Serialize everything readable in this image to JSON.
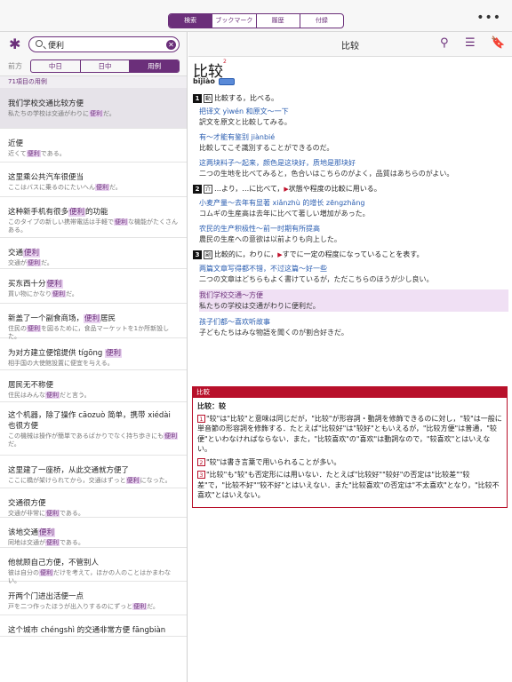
{
  "tabs": [
    "検索",
    "ブックマーク",
    "履歴",
    "付録"
  ],
  "search": {
    "value": "便利",
    "filter_label": "前方",
    "filters": [
      "中日",
      "日中",
      "用例"
    ],
    "count": "71項目の用例"
  },
  "results": [
    {
      "zh": "我们学校交通比较方便",
      "ja": "私たちの学校は交通がわりに便利だ。"
    },
    {
      "zh": "近便",
      "ja": "近くて便利である。"
    },
    {
      "zh": "这里乘公共汽车很便当",
      "ja": "ここはバスに乗るのにたいへん便利だ。"
    },
    {
      "zh": "这种新手机有很多便利的功能",
      "ja": "このタイプの新しい携帯電話は手軽で便利な機能がたくさんある。"
    },
    {
      "zh": "交通便利",
      "ja": "交通が便利だ。"
    },
    {
      "zh": "买东西十分便利",
      "ja": "買い物にかなり便利だ。"
    },
    {
      "zh": "新盖了一个副食商场，便利居民",
      "ja": "住民の便利を図るために，食品マーケットを1か所新設した。"
    },
    {
      "zh": "为对方建立便馆提供 tígōng 便利",
      "ja": "相手国の大使館設置に便宜を与える。"
    },
    {
      "zh": "居民无不称便",
      "ja": "住民はみんな便利だと言う。"
    },
    {
      "zh": "这个机器，除了操作 cāozuò 简单，携带 xiédài 也很方便",
      "ja": "この機械は操作が簡単であるばかりでなく持ち歩きにも便利だ。"
    },
    {
      "zh": "这里建了一座桥，从此交通就方便了",
      "ja": "ここに橋が架けられてから，交通はずっと便利になった。"
    },
    {
      "zh": "交通很方便",
      "ja": "交通が非常に便利である。"
    },
    {
      "zh": "该地交通便利",
      "ja": "同地は交通が便利である。"
    },
    {
      "zh": "他就顾自己方便，不管别人",
      "ja": "彼は自分の便利だけを考えて，ほかの人のことはかまわない。"
    },
    {
      "zh": "开两个门进出活便一点",
      "ja": "戸を二つ作ったほうが出入りするのにずっと便利だ。"
    },
    {
      "zh": "这个城市 chéngshì 的交通非常方便 fāngbiàn",
      "ja": ""
    }
  ],
  "entry": {
    "header_title": "比较",
    "headword": "比较",
    "superscript": "2",
    "pinyin": "bǐjiào",
    "s1": {
      "num": "1",
      "pos": "動",
      "def": "比較する，比べる。",
      "ex": [
        {
          "c": "把译文 yìwén 和原文～一下",
          "j": "訳文を原文と比較してみる。"
        },
        {
          "c": "有～才能有鉴别 jiànbié",
          "j": "比較してこそ識別することができるのだ。"
        },
        {
          "c": "这两块料子～起来，颜色是这块好，质地是那块好",
          "j": "二つの生地を比べてみると，色合いはこちらのがよく，品質はあちらのがよい。"
        }
      ]
    },
    "s2": {
      "num": "2",
      "pos": "介",
      "def": "…より，…に比べて，",
      "def2": "状態や程度の比較に用いる。",
      "ex": [
        {
          "c": "小麦产量～去年有显著 xiǎnzhù 的增长 zēngzhǎng",
          "j": "コムギの生産高は去年に比べて著しい増加があった。"
        },
        {
          "c": "农民的生产积极性～前一时期有所提高",
          "j": "農民の生産への意欲は以前よりも向上した。"
        }
      ]
    },
    "s3": {
      "num": "3",
      "pos": "副",
      "def": "比較的に，わりに，",
      "def2": "すでに一定の程度になっていることを表す。",
      "ex": [
        {
          "c": "两篇文章写得都不错，不过这篇～好一些",
          "j": "二つの文章はどちらもよく書けているが，ただこちらのほうが少し良い。"
        },
        {
          "c": "我们学校交通～方便",
          "j": "私たちの学校は交通がわりに便利だ。"
        },
        {
          "c": "孩子们都～喜欢听故事",
          "j": "子どもたちはみな物語を聞くのが割合好きだ。"
        }
      ]
    },
    "note": {
      "header": "比較",
      "title": "比较：较",
      "p1": "\"较\"は\"比较\"と意味は同じだが，\"比较\"が形容詞・動詞を修飾できるのに対し，\"较\"は一般に単音節の形容詞を修飾する．たとえば\"比较好\"は\"较好\"ともいえるが，\"比较方便\"は普通，\"较便\"といわなければならない．また，\"比较喜欢\"の\"喜欢\"は動詞なので，\"较喜欢\"とはいえない。",
      "p2": "\"较\"は書き言葉で用いられることが多い。",
      "p3": "\"比较\"も\"较\"も否定形には用いない．たとえば\"比较好\"\"较好\"の否定は\"比较差\"\"较差\"で，\"比较不好\"\"较不好\"とはいえない．また\"比较喜欢\"の否定は\"不太喜欢\"となり，\"比较不喜欢\"とはいえない。"
    }
  }
}
